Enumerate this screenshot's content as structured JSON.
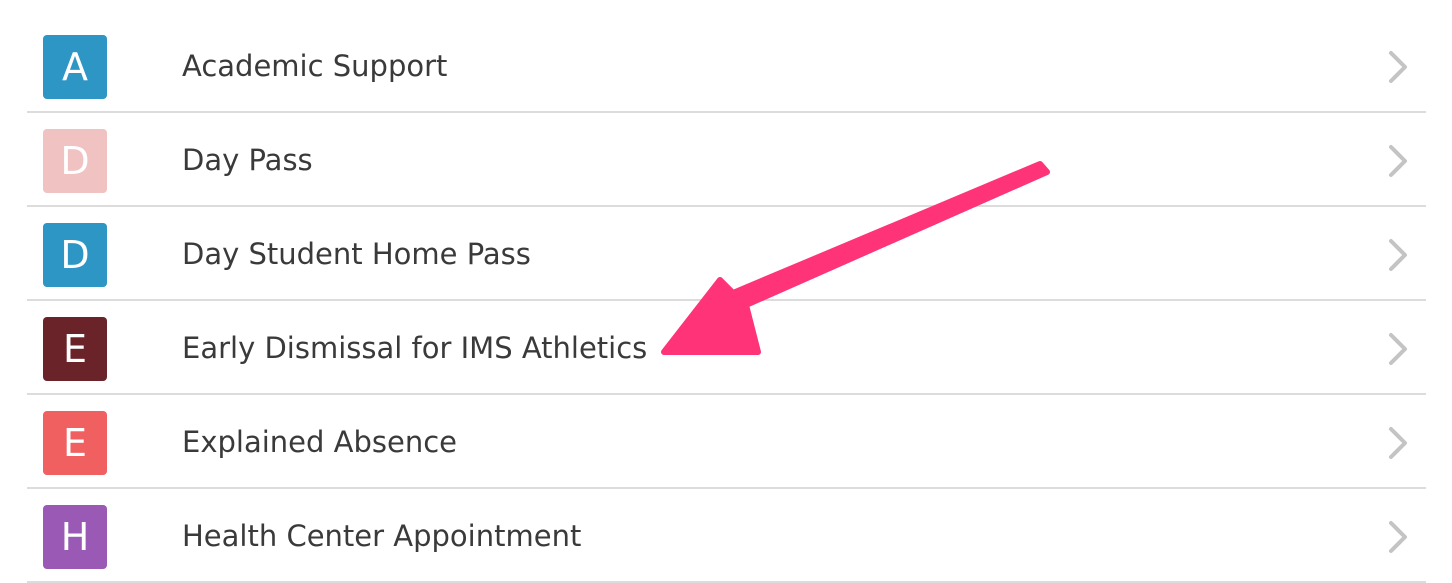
{
  "list": {
    "items": [
      {
        "letter": "A",
        "label": "Academic Support",
        "color": "#2e96c5"
      },
      {
        "letter": "D",
        "label": "Day Pass",
        "color": "#f0c2c2"
      },
      {
        "letter": "D",
        "label": "Day Student Home Pass",
        "color": "#2e96c5"
      },
      {
        "letter": "E",
        "label": "Early Dismissal for IMS Athletics",
        "color": "#6b232a"
      },
      {
        "letter": "E",
        "label": "Explained Absence",
        "color": "#f06060"
      },
      {
        "letter": "H",
        "label": "Health Center Appointment",
        "color": "#9b59b6"
      }
    ]
  },
  "colors": {
    "annotation_arrow": "#ff3377",
    "chevron": "#c4c4c4",
    "divider": "#dcdcdc",
    "text": "#3a3a3a"
  },
  "icons": {
    "row_chevron": "chevron-right-icon",
    "annotation": "pointer-arrow-icon"
  }
}
